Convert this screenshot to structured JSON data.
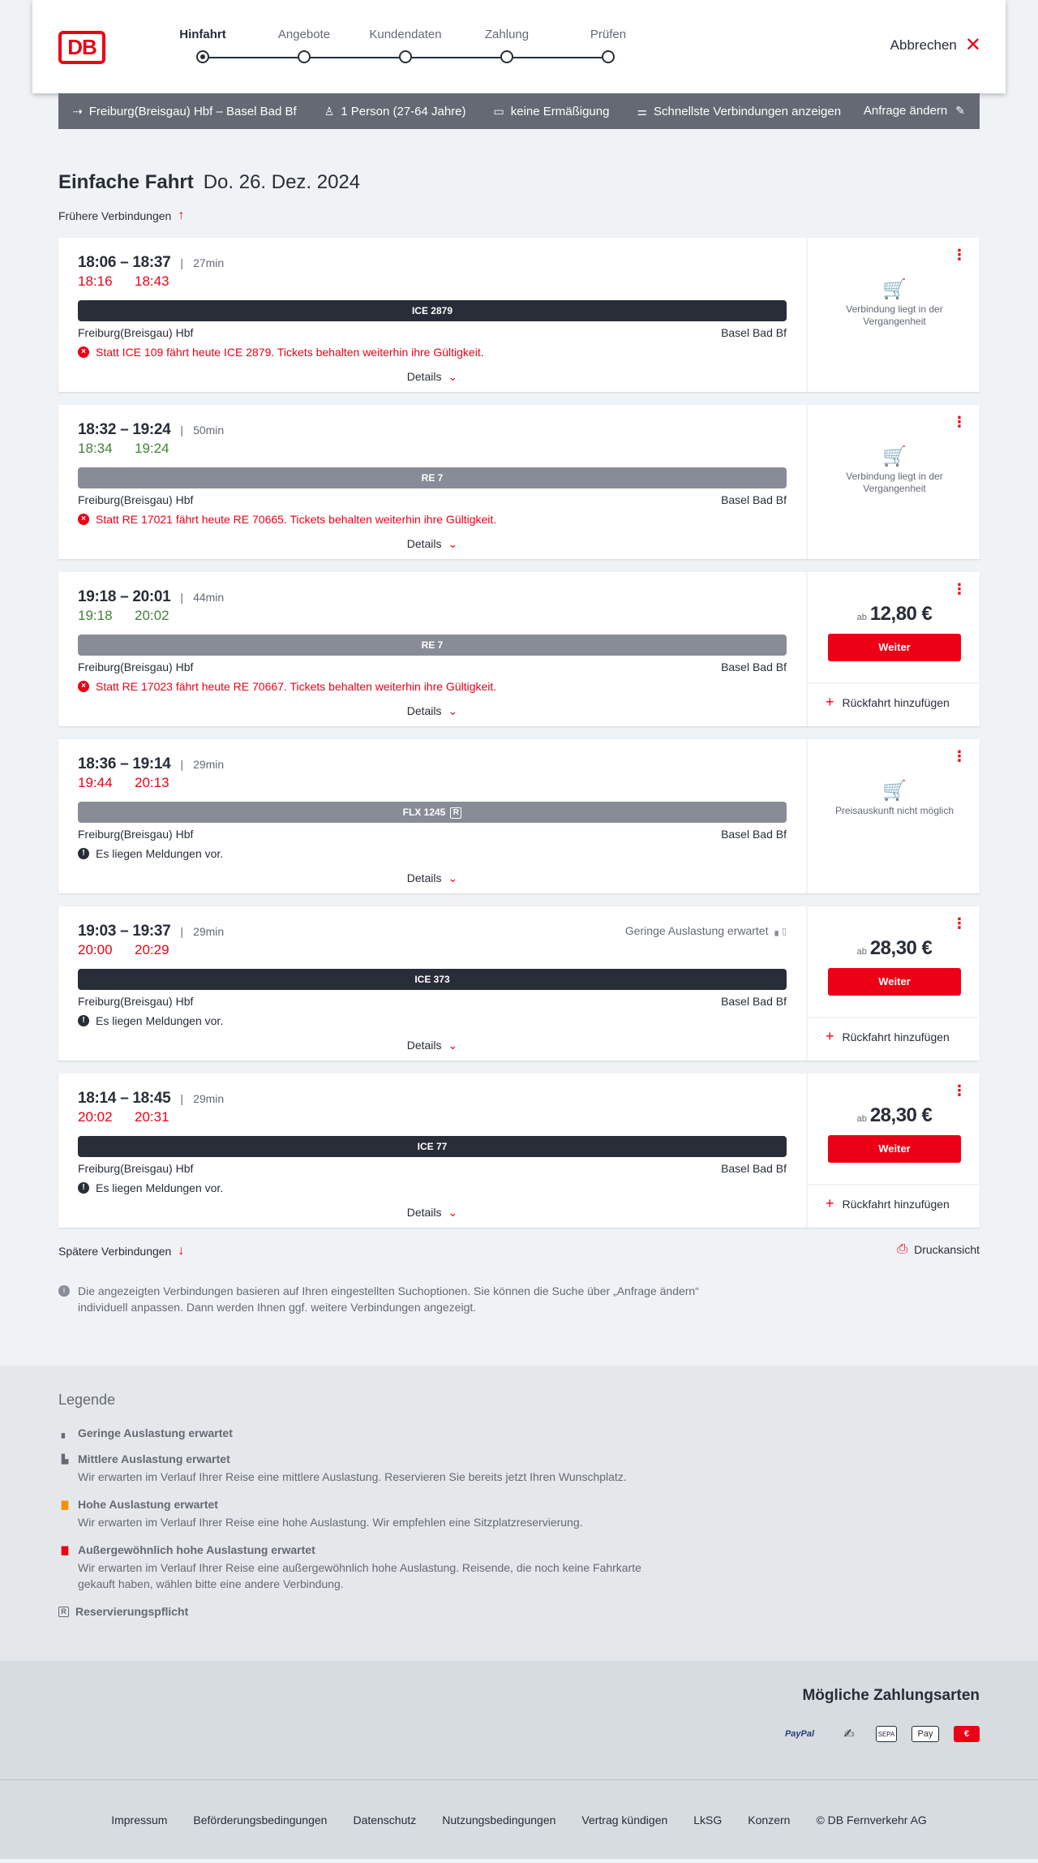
{
  "header": {
    "logo": "DB",
    "steps": [
      "Hinfahrt",
      "Angebote",
      "Kundendaten",
      "Zahlung",
      "Prüfen"
    ],
    "cancel": "Abbrechen"
  },
  "filter": {
    "route": "Freiburg(Breisgau) Hbf – Basel Bad Bf",
    "person": "1 Person (27-64 Jahre)",
    "discount": "keine Ermäßigung",
    "fastest": "Schnellste Verbindungen anzeigen",
    "edit": "Anfrage ändern"
  },
  "page": {
    "title": "Einfache Fahrt",
    "date": "Do. 26. Dez. 2024",
    "earlier": "Frühere Verbindungen",
    "later": "Spätere Verbindungen",
    "print": "Druckansicht",
    "info": "Die angezeigten Verbindungen basieren auf Ihren eingestellten Suchoptionen. Sie können die Suche über „Anfrage ändern“ individuell anpassen. Dann werden Ihnen ggf. weitere Verbindungen angezeigt."
  },
  "common": {
    "from": "Freiburg(Breisgau) Hbf",
    "to": "Basel Bad Bf",
    "details": "Details",
    "weiter": "Weiter",
    "ab": "ab",
    "return": "Rückfahrt hinzufügen"
  },
  "connections": [
    {
      "time": "18:06 – 18:37",
      "duration": "27min",
      "rt_dep": "18:16",
      "rt_arr": "18:43",
      "rt_color": "red",
      "train": "ICE 2879",
      "train_style": "dark",
      "reservation": false,
      "occupancy": "",
      "message": "Statt ICE 109 fährt heute ICE 2879. Tickets behalten weiterhin ihre Gültigkeit.",
      "message_type": "error",
      "status": "past",
      "status_text": "Verbindung liegt in der Vergangenheit",
      "price": ""
    },
    {
      "time": "18:32 – 19:24",
      "duration": "50min",
      "rt_dep": "18:34",
      "rt_arr": "19:24",
      "rt_color": "green",
      "train": "RE 7",
      "train_style": "grey",
      "reservation": false,
      "occupancy": "",
      "message": "Statt RE 17021 fährt heute RE 70665. Tickets behalten weiterhin ihre Gültigkeit.",
      "message_type": "error",
      "status": "past",
      "status_text": "Verbindung liegt in der Vergangenheit",
      "price": ""
    },
    {
      "time": "19:18 – 20:01",
      "duration": "44min",
      "rt_dep": "19:18",
      "rt_arr": "20:02",
      "rt_color": "green",
      "train": "RE 7",
      "train_style": "grey",
      "reservation": false,
      "occupancy": "",
      "message": "Statt RE 17023 fährt heute RE 70667. Tickets behalten weiterhin ihre Gültigkeit.",
      "message_type": "error",
      "status": "price",
      "status_text": "",
      "price": "12,80 €"
    },
    {
      "time": "18:36 – 19:14",
      "duration": "29min",
      "rt_dep": "19:44",
      "rt_arr": "20:13",
      "rt_color": "red",
      "train": "FLX 1245",
      "train_style": "grey",
      "reservation": true,
      "occupancy": "",
      "message": "Es liegen Meldungen vor.",
      "message_type": "info",
      "status": "past",
      "status_text": "Preisauskunft nicht möglich",
      "price": ""
    },
    {
      "time": "19:03 – 19:37",
      "duration": "29min",
      "rt_dep": "20:00",
      "rt_arr": "20:29",
      "rt_color": "red",
      "train": "ICE 373",
      "train_style": "dark",
      "reservation": false,
      "occupancy": "Geringe Auslastung erwartet",
      "message": "Es liegen Meldungen vor.",
      "message_type": "info",
      "status": "price",
      "status_text": "",
      "price": "28,30 €"
    },
    {
      "time": "18:14 – 18:45",
      "duration": "29min",
      "rt_dep": "20:02",
      "rt_arr": "20:31",
      "rt_color": "red",
      "train": "ICE 77",
      "train_style": "dark",
      "reservation": false,
      "occupancy": "",
      "message": "Es liegen Meldungen vor.",
      "message_type": "info",
      "status": "price",
      "status_text": "",
      "price": "28,30 €"
    }
  ],
  "legend": {
    "title": "Legende",
    "items": [
      {
        "title": "Geringe Auslastung erwartet",
        "desc": "",
        "icon": "▖",
        "color": "#646973"
      },
      {
        "title": "Mittlere Auslastung erwartet",
        "desc": "Wir erwarten im Verlauf Ihrer Reise eine mittlere Auslastung. Reservieren Sie bereits jetzt Ihren Wunschplatz.",
        "icon": "▙",
        "color": "#646973"
      },
      {
        "title": "Hohe Auslastung erwartet",
        "desc": "Wir erwarten im Verlauf Ihrer Reise eine hohe Auslastung. Wir empfehlen eine Sitzplatzreservierung.",
        "icon": "▇",
        "color": "#f39200"
      },
      {
        "title": "Außergewöhnlich hohe Auslastung erwartet",
        "desc": "Wir erwarten im Verlauf Ihrer Reise eine außergewöhnlich hohe Auslastung. Reisende, die noch keine Fahrkarte gekauft haben, wählen bitte eine andere Verbindung.",
        "icon": "▇",
        "color": "#ec0016"
      },
      {
        "title": "Reservierungspflicht",
        "desc": "",
        "icon": "R",
        "color": "#646973"
      }
    ]
  },
  "payments": {
    "title": "Mögliche Zahlungsarten",
    "methods": [
      "PayPal",
      "✍",
      "SEPA",
      "Pay",
      "€"
    ]
  },
  "footer": [
    "Impressum",
    "Beförderungsbedingungen",
    "Datenschutz",
    "Nutzungsbedingungen",
    "Vertrag kündigen",
    "LkSG",
    "Konzern",
    "© DB Fernverkehr AG"
  ],
  "colors": {
    "brand": "#ec0016",
    "delay": "#ec0016",
    "ontime": "#408335",
    "dark": "#282d37"
  }
}
